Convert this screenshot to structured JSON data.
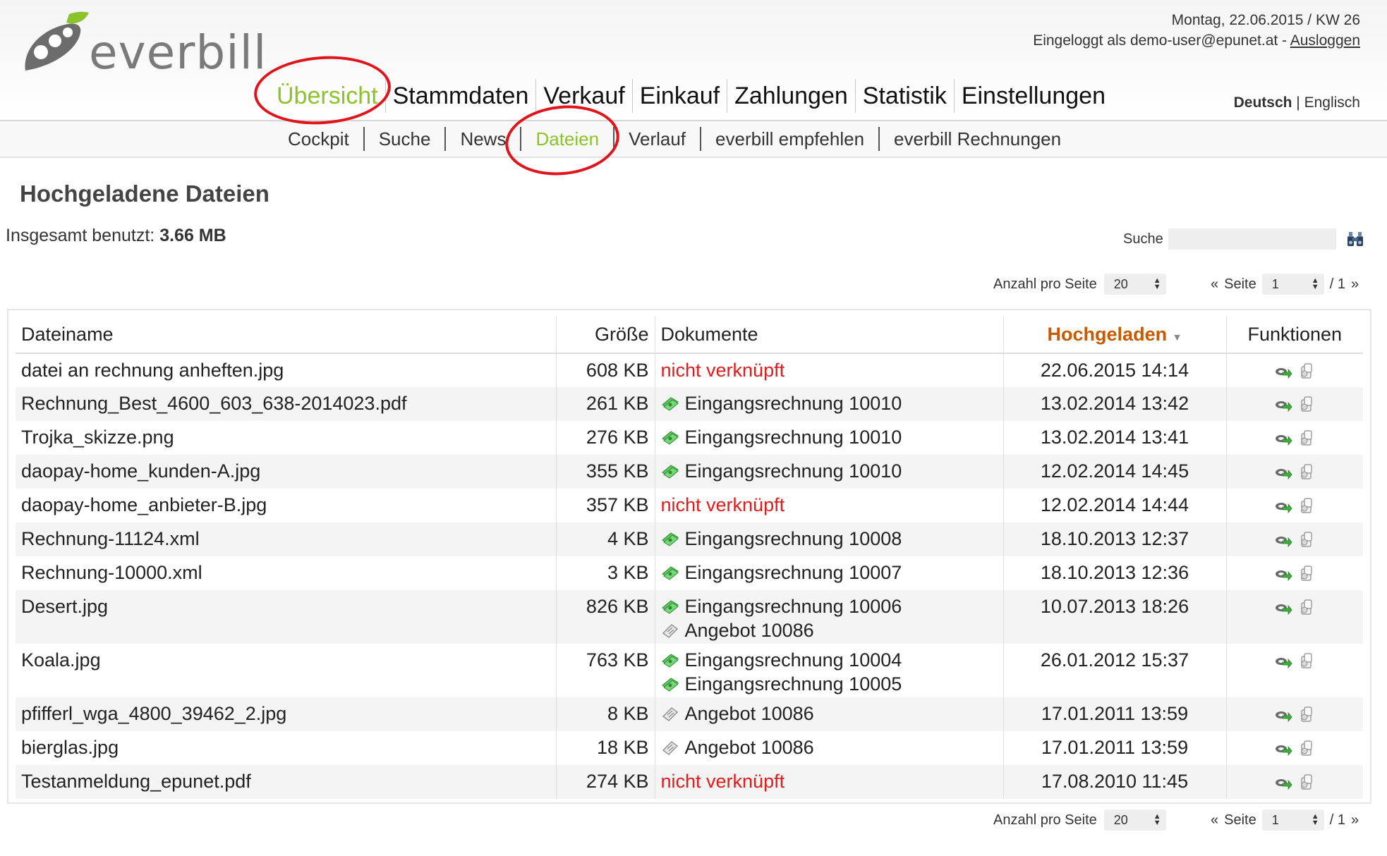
{
  "app": {
    "logo_text": "everbill"
  },
  "topinfo": {
    "date": "Montag, 22.06.2015 / KW 26",
    "login_prefix": "Eingeloggt als demo-user@epunet.at -",
    "logout": "Ausloggen"
  },
  "mainnav": [
    "Übersicht",
    "Stammdaten",
    "Verkauf",
    "Einkauf",
    "Zahlungen",
    "Statistik",
    "Einstellungen"
  ],
  "lang": {
    "active": "Deutsch",
    "sep": "|",
    "other": "Englisch"
  },
  "subnav": [
    "Cockpit",
    "Suche",
    "News",
    "Dateien",
    "Verlauf",
    "everbill empfehlen",
    "everbill Rechnungen"
  ],
  "page": {
    "title": "Hochgeladene Dateien",
    "usage_label": "Insgesamt benutzt:",
    "usage_value": "3.66 MB",
    "search_label": "Suche",
    "search_value": ""
  },
  "pager": {
    "per_page_label": "Anzahl pro Seite",
    "per_page": "20",
    "prev": "«",
    "page_label": "Seite",
    "page": "1",
    "total": "/ 1",
    "next": "»"
  },
  "table": {
    "headers": [
      "Dateiname",
      "Größe",
      "Dokumente",
      "Hochgeladen",
      "Funktionen"
    ],
    "rows": [
      {
        "name": "datei an rechnung anheften.jpg",
        "size": "608 KB",
        "docs": [
          {
            "type": "none",
            "label": "nicht verknüpft"
          }
        ],
        "uploaded": "22.06.2015 14:14"
      },
      {
        "name": "Rechnung_Best_4600_603_638-2014023.pdf",
        "size": "261 KB",
        "docs": [
          {
            "type": "invoice",
            "label": "Eingangsrechnung 10010"
          }
        ],
        "uploaded": "13.02.2014 13:42"
      },
      {
        "name": "Trojka_skizze.png",
        "size": "276 KB",
        "docs": [
          {
            "type": "invoice",
            "label": "Eingangsrechnung 10010"
          }
        ],
        "uploaded": "13.02.2014 13:41"
      },
      {
        "name": "daopay-home_kunden-A.jpg",
        "size": "355 KB",
        "docs": [
          {
            "type": "invoice",
            "label": "Eingangsrechnung 10010"
          }
        ],
        "uploaded": "12.02.2014 14:45"
      },
      {
        "name": "daopay-home_anbieter-B.jpg",
        "size": "357 KB",
        "docs": [
          {
            "type": "none",
            "label": "nicht verknüpft"
          }
        ],
        "uploaded": "12.02.2014 14:44"
      },
      {
        "name": "Rechnung-11124.xml",
        "size": "4 KB",
        "docs": [
          {
            "type": "invoice",
            "label": "Eingangsrechnung 10008"
          }
        ],
        "uploaded": "18.10.2013 12:37"
      },
      {
        "name": "Rechnung-10000.xml",
        "size": "3 KB",
        "docs": [
          {
            "type": "invoice",
            "label": "Eingangsrechnung 10007"
          }
        ],
        "uploaded": "18.10.2013 12:36"
      },
      {
        "name": "Desert.jpg",
        "size": "826 KB",
        "docs": [
          {
            "type": "invoice",
            "label": "Eingangsrechnung 10006"
          },
          {
            "type": "offer",
            "label": "Angebot 10086"
          }
        ],
        "uploaded": "10.07.2013 18:26"
      },
      {
        "name": "Koala.jpg",
        "size": "763 KB",
        "docs": [
          {
            "type": "invoice",
            "label": "Eingangsrechnung 10004"
          },
          {
            "type": "invoice",
            "label": "Eingangsrechnung 10005"
          }
        ],
        "uploaded": "26.01.2012 15:37"
      },
      {
        "name": "pfifferl_wga_4800_39462_2.jpg",
        "size": "8 KB",
        "docs": [
          {
            "type": "offer",
            "label": "Angebot 10086"
          }
        ],
        "uploaded": "17.01.2011 13:59"
      },
      {
        "name": "bierglas.jpg",
        "size": "18 KB",
        "docs": [
          {
            "type": "offer",
            "label": "Angebot 10086"
          }
        ],
        "uploaded": "17.01.2011 13:59"
      },
      {
        "name": "Testanmeldung_epunet.pdf",
        "size": "274 KB",
        "docs": [
          {
            "type": "none",
            "label": "nicht verknüpft"
          }
        ],
        "uploaded": "17.08.2010 11:45"
      }
    ]
  },
  "colors": {
    "accent_green": "#8cc32a",
    "sorted_header": "#c85a00",
    "unlinked": "#e21b1b",
    "highlight_circle": "#e0141a"
  },
  "icons": {
    "invoice": "money-icon",
    "offer": "offer-icon",
    "link": "link-arrow-icon",
    "delete": "delete-icon",
    "search": "binoculars-icon"
  }
}
